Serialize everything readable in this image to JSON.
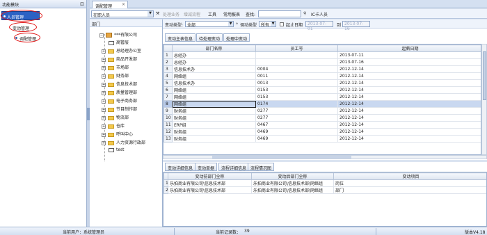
{
  "left_panel": {
    "title": "功能模块",
    "nav": [
      {
        "label": "人员管理"
      },
      {
        "label": "变动管理"
      },
      {
        "label": "调配管理"
      }
    ]
  },
  "main_tab": {
    "label": "调配管理"
  },
  "toolbar": {
    "person_combo": "在职人员",
    "items": [
      "处理业务",
      "增减流程",
      "工具",
      "常用报表",
      "查找:",
      "IC卡人员"
    ]
  },
  "dept_panel": {
    "title": "部门",
    "root": "***有限公司",
    "nodes": [
      "高管层",
      "总经理办公室",
      "商品开发部",
      "市场部",
      "财务部",
      "信息技术部",
      "质量管理部",
      "电子商务部",
      "节目制作部",
      "物流部",
      "仓库",
      "呼叫中心",
      "人力资源行政部",
      "test"
    ]
  },
  "filter": {
    "type_label": "变动类型:",
    "type_value": "全部",
    "sub_label": "调动类型",
    "sub_value": "所有",
    "date_label": "起止日期",
    "date_from": "2013-07-01",
    "date_to_label": "到",
    "date_to": "2013-07-16"
  },
  "actions": [
    "变动主表信息",
    "待处理变动",
    "处理中变动"
  ],
  "grid": {
    "columns": [
      "部门名称",
      "员工号",
      "起薪日期"
    ],
    "rows": [
      {
        "n": "1",
        "dept": "总经办",
        "id": "",
        "date": "2013-07-11"
      },
      {
        "n": "2",
        "dept": "总经办",
        "id": "",
        "date": "2013-07-16"
      },
      {
        "n": "3",
        "dept": "信息技术办",
        "id": "0004",
        "date": "2012-12-14"
      },
      {
        "n": "4",
        "dept": "网络组",
        "id": "0011",
        "date": "2012-12-14"
      },
      {
        "n": "5",
        "dept": "信息技术办",
        "id": "0013",
        "date": "2012-12-14"
      },
      {
        "n": "6",
        "dept": "网络组",
        "id": "0153",
        "date": "2012-12-14"
      },
      {
        "n": "7",
        "dept": "网络组",
        "id": "0153",
        "date": "2012-12-14"
      },
      {
        "n": "8",
        "dept": "网络组",
        "id": "0174",
        "date": "2012-12-14"
      },
      {
        "n": "9",
        "dept": "财务组",
        "id": "0277",
        "date": "2012-12-14"
      },
      {
        "n": "10",
        "dept": "财务组",
        "id": "0277",
        "date": "2012-12-14"
      },
      {
        "n": "11",
        "dept": "ERP组",
        "id": "0467",
        "date": "2012-12-14"
      },
      {
        "n": "12",
        "dept": "财务组",
        "id": "0469",
        "date": "2012-12-14"
      },
      {
        "n": "13",
        "dept": "财务组",
        "id": "0469",
        "date": "2012-12-14"
      }
    ],
    "selected_row": "8"
  },
  "subtabs": [
    "变动详细信息",
    "变动单据",
    "流程详细信息",
    "流程情况图"
  ],
  "detail": {
    "columns": [
      "变动前部门全称",
      "变动后部门全称",
      "变动项目"
    ],
    "rows": [
      {
        "n": "1",
        "before": "乐拍商业有限公司\\信息技术部",
        "after": "乐拍商业有限公司\\信息技术部\\网络组",
        "item": "岗位"
      },
      {
        "n": "2",
        "before": "乐拍商业有限公司\\信息技术部",
        "after": "乐拍商业有限公司\\信息技术部\\网络组",
        "item": "部门"
      }
    ]
  },
  "status": {
    "user": "当前用户：系统管理员",
    "records_label": "当前记录数：",
    "records": "39",
    "version": "版本V4.18"
  }
}
